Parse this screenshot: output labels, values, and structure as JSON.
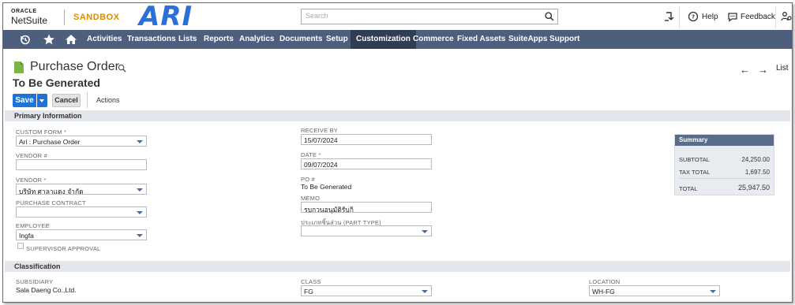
{
  "header": {
    "oracle_label": "ORACLE",
    "netsuite_label": "NetSuite",
    "sandbox_label": "SANDBOX",
    "company_logo_text": "ARI",
    "search_placeholder": "Search",
    "help_label": "Help",
    "feedback_label": "Feedback"
  },
  "nav": {
    "items": [
      "Activities",
      "Transactions",
      "Lists",
      "Reports",
      "Analytics",
      "Documents",
      "Setup",
      "Customization",
      "Commerce",
      "Fixed Assets",
      "SuiteApps",
      "Support"
    ],
    "active": "Customization"
  },
  "page": {
    "title": "Purchase Order",
    "subtitle": "To Be Generated",
    "back_arrow": "←",
    "forward_arrow": "→",
    "list_label": "List",
    "save_label": "Save",
    "cancel_label": "Cancel",
    "actions_label": "Actions"
  },
  "primary": {
    "section_title": "Primary Information",
    "custom_form": {
      "label": "CUSTOM FORM",
      "value": "Ari : Purchase Order"
    },
    "vendor_no": {
      "label": "VENDOR #",
      "value": ""
    },
    "vendor": {
      "label": "VENDOR",
      "value": "บริษัท ศาลาแดง จำกัด"
    },
    "purchase_contract": {
      "label": "PURCHASE CONTRACT",
      "value": ""
    },
    "employee": {
      "label": "EMPLOYEE",
      "value": "Ingfa"
    },
    "supervisor_approval": {
      "label": "SUPERVISOR APPROVAL",
      "checked": false
    },
    "receive_by": {
      "label": "RECEIVE BY",
      "value": "15/07/2024"
    },
    "date": {
      "label": "DATE",
      "value": "09/07/2024"
    },
    "po_no": {
      "label": "PO #",
      "value": "To Be Generated"
    },
    "memo": {
      "label": "MEMO",
      "value": "รบกวนอนุมัติรับกิ"
    },
    "part_type": {
      "label": "ประเภทชิ้นส่วน (PART TYPE)",
      "value": ""
    }
  },
  "summary": {
    "title": "Summary",
    "subtotal_label": "SUBTOTAL",
    "subtotal": "24,250.00",
    "tax_total_label": "TAX TOTAL",
    "tax_total": "1,697.50",
    "total_label": "TOTAL",
    "total": "25,947.50"
  },
  "classification": {
    "section_title": "Classification",
    "subsidiary": {
      "label": "SUBSIDIARY",
      "value": "Sala Daeng Co.,Ltd."
    },
    "class": {
      "label": "CLASS",
      "value": "FG"
    },
    "location": {
      "label": "LOCATION",
      "value": "WH-FG"
    }
  },
  "colors": {
    "nav_bg": "#4d5f7c",
    "nav_active": "#2f3e55",
    "primary_button": "#1d73d6",
    "sandbox": "#e08a00",
    "logo": "#2b6fd8"
  }
}
